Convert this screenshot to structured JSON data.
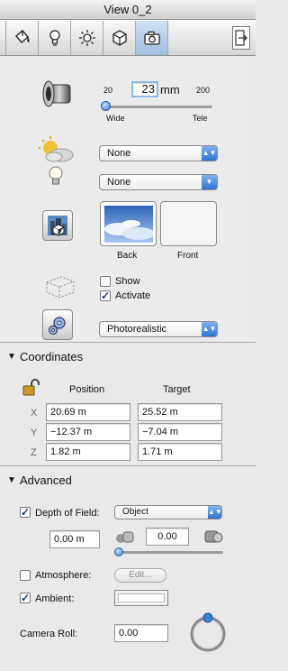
{
  "window": {
    "title": "View 0_2"
  },
  "toolbar": {
    "tabs": [
      {
        "icon": "paint-bucket-icon"
      },
      {
        "icon": "light-bulb-icon"
      },
      {
        "icon": "sun-icon"
      },
      {
        "icon": "cube-icon"
      },
      {
        "icon": "camera-icon",
        "active": true
      }
    ],
    "detach_icon": "detach-panel-icon"
  },
  "lens": {
    "focal_value": "23",
    "unit": "mm",
    "min_label": "20",
    "max_label": "200",
    "wide_label": "Wide",
    "tele_label": "Tele",
    "slider_fraction": 0.02
  },
  "environment": {
    "sky_value": "None",
    "light_value": "None"
  },
  "background": {
    "back_label": "Back",
    "front_label": "Front"
  },
  "bounding": {
    "show_label": "Show",
    "show_checked": false,
    "activate_label": "Activate",
    "activate_checked": true
  },
  "render": {
    "mode_value": "Photorealistic"
  },
  "coordinates": {
    "title": "Coordinates",
    "position_header": "Position",
    "target_header": "Target",
    "rows": [
      {
        "axis": "X",
        "position": "20.69 m",
        "target": "25.52 m"
      },
      {
        "axis": "Y",
        "position": "−12.37 m",
        "target": "−7.04 m"
      },
      {
        "axis": "Z",
        "position": "1.82 m",
        "target": "1.71 m"
      }
    ]
  },
  "advanced": {
    "title": "Advanced",
    "dof_label": "Depth of Field:",
    "dof_checked": true,
    "dof_mode": "Object",
    "dof_distance": "0.00 m",
    "dof_amount": "0.00",
    "atmosphere_label": "Atmosphere:",
    "atmosphere_checked": false,
    "edit_label": "Edit...",
    "ambient_label": "Ambient:",
    "ambient_checked": true,
    "camera_roll_label": "Camera Roll:",
    "camera_roll_value": "0.00"
  },
  "colors": {
    "accent": "#2f72d0",
    "check": "#18377a"
  }
}
